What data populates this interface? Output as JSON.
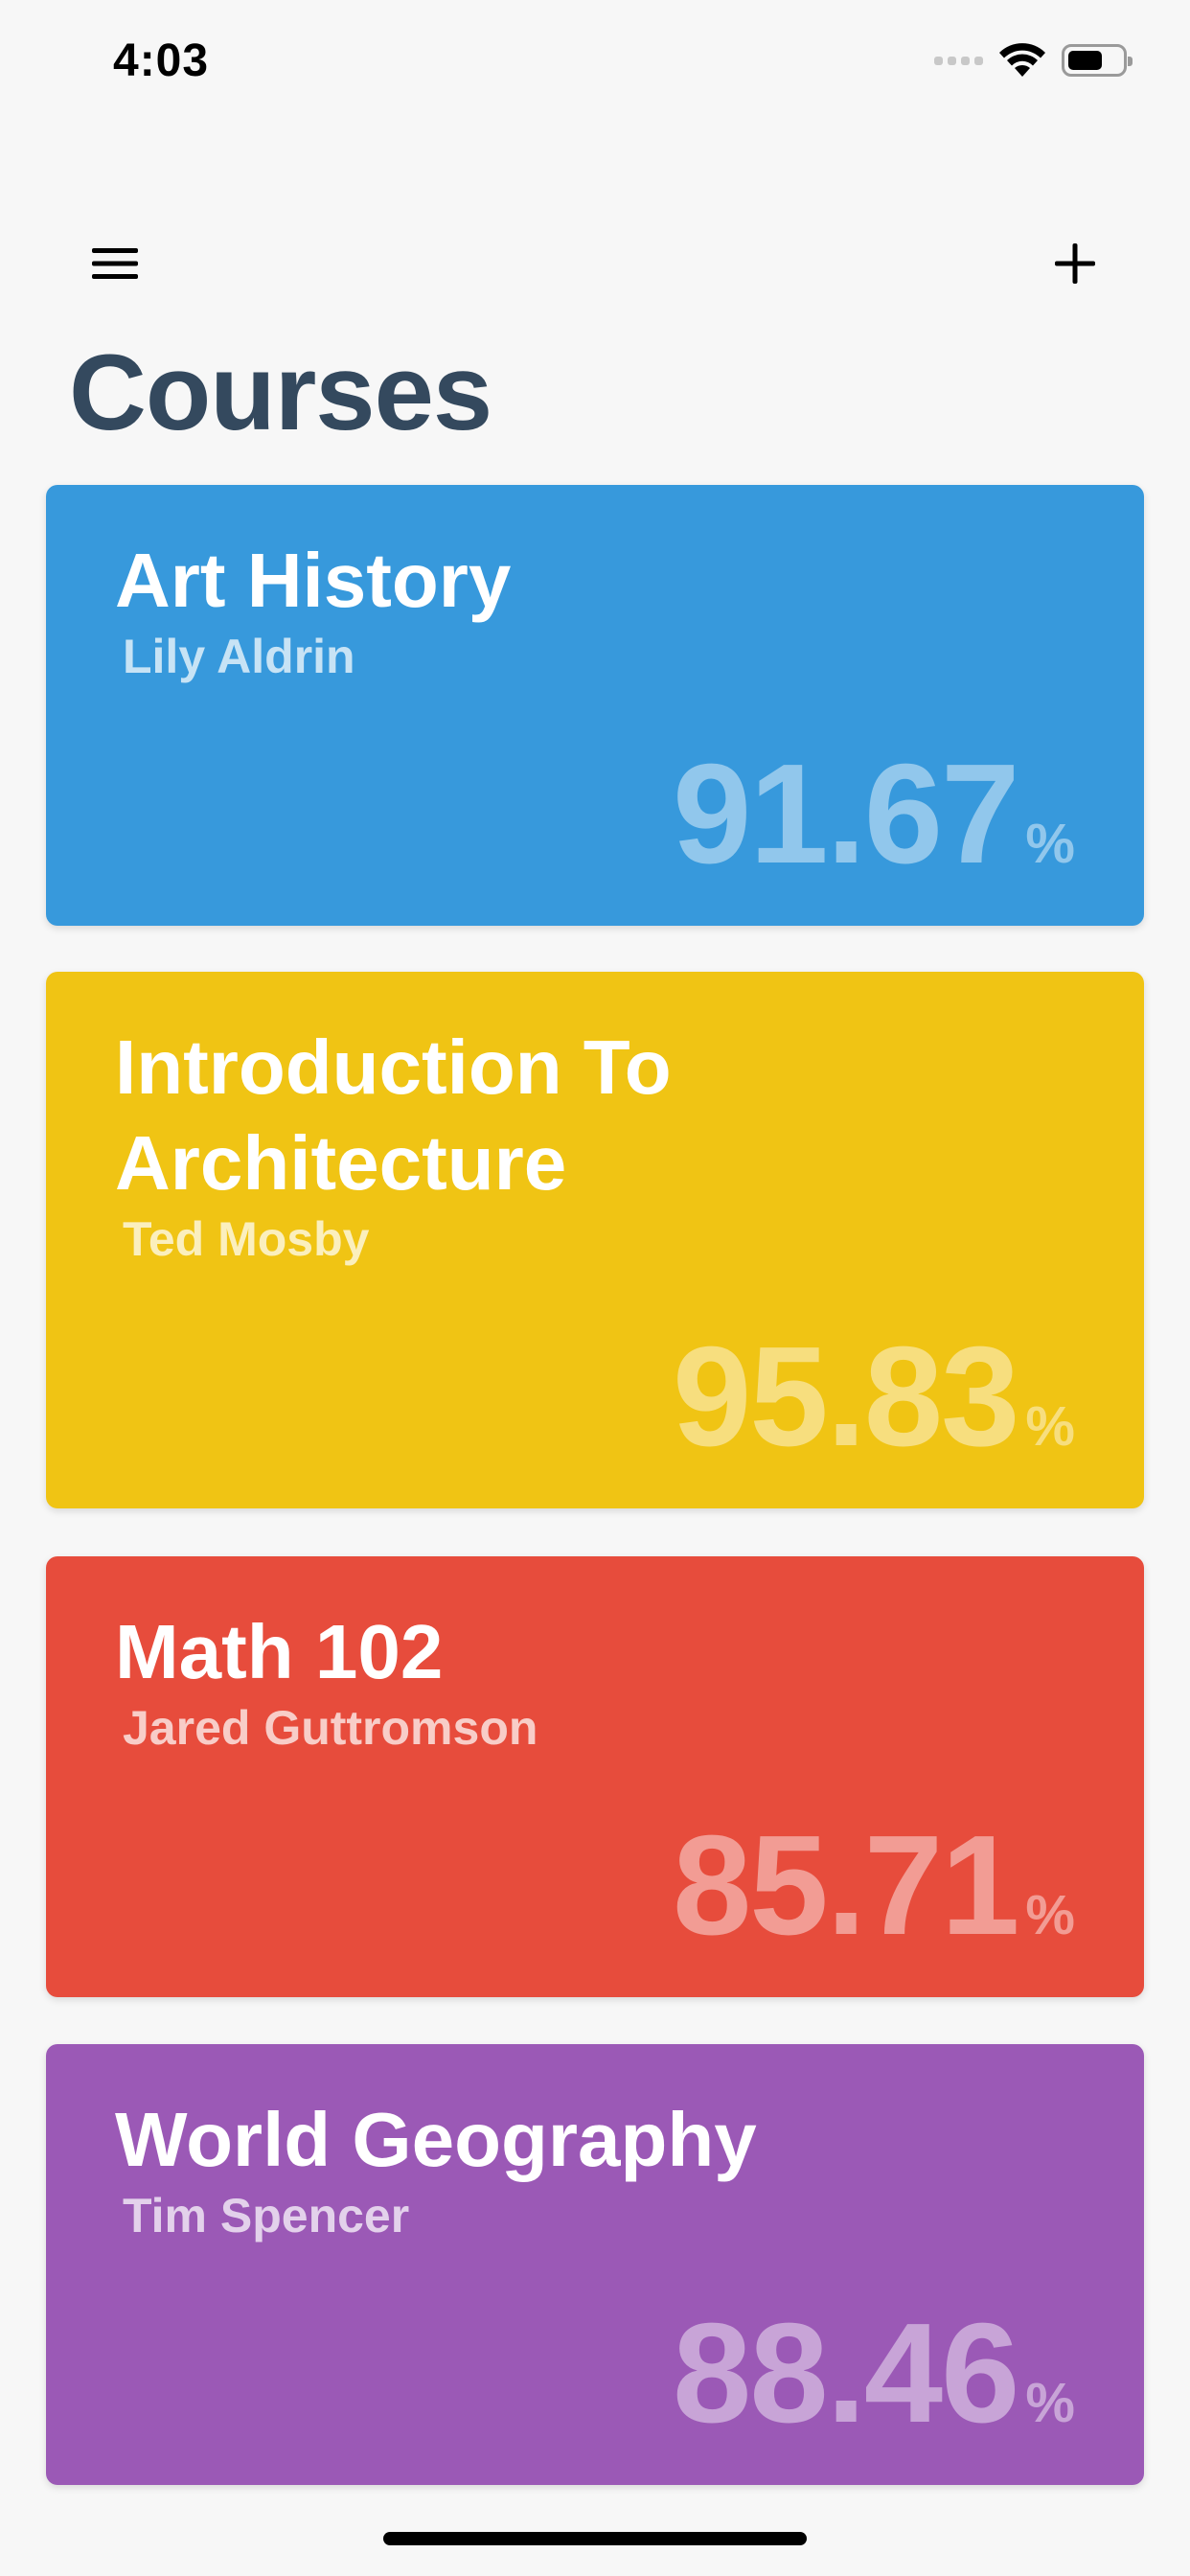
{
  "status_bar": {
    "time": "4:03"
  },
  "nav": {
    "menu_icon": "hamburger-icon",
    "add_icon": "plus-icon"
  },
  "title": "Courses",
  "courses": [
    {
      "name": "Art History",
      "teacher": "Lily Aldrin",
      "grade": "91.67",
      "unit": "%",
      "color": "#3799dc"
    },
    {
      "name": "Introduction To Architecture",
      "teacher": "Ted Mosby",
      "grade": "95.83",
      "unit": "%",
      "color": "#f0c414"
    },
    {
      "name": "Math 102",
      "teacher": "Jared Guttromson",
      "grade": "85.71",
      "unit": "%",
      "color": "#e74c3c"
    },
    {
      "name": "World Geography",
      "teacher": "Tim Spencer",
      "grade": "88.46",
      "unit": "%",
      "color": "#9b59b6"
    }
  ]
}
